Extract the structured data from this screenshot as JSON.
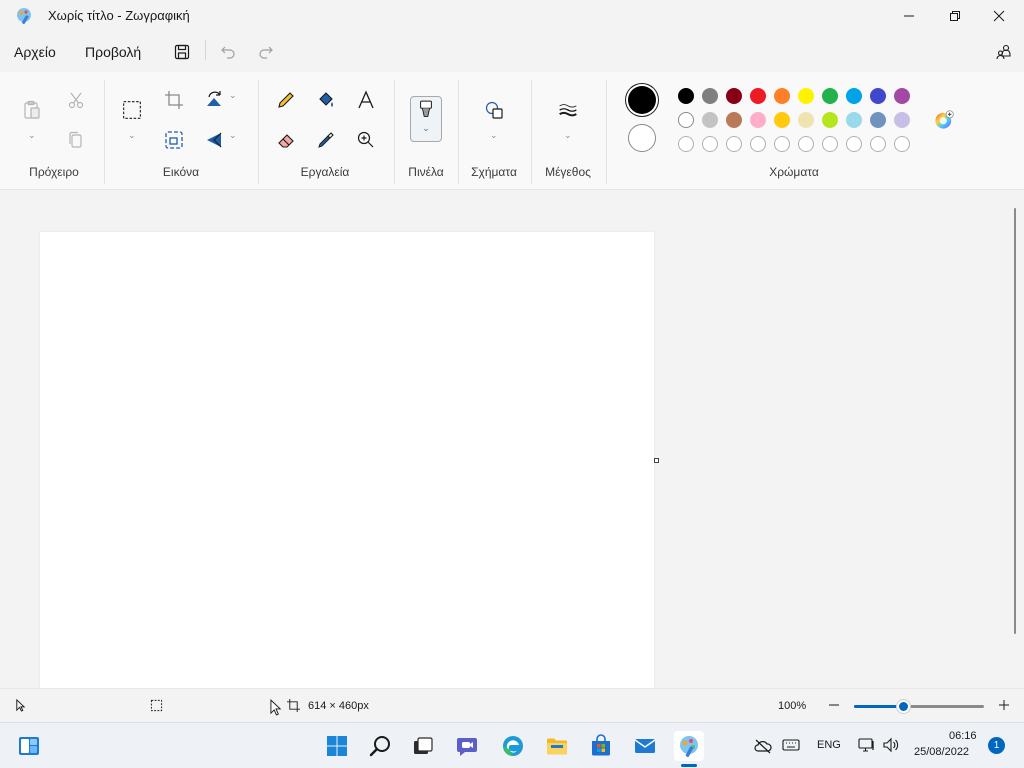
{
  "window": {
    "title": "Χωρίς τίτλο - Ζωγραφική"
  },
  "menu": {
    "file": "Αρχείο",
    "view": "Προβολή"
  },
  "ribbon": {
    "groups": {
      "clipboard": "Πρόχειρο",
      "image": "Εικόνα",
      "tools": "Εργαλεία",
      "brushes": "Πινέλα",
      "shapes": "Σχήματα",
      "size": "Μέγεθος",
      "colors": "Χρώματα"
    },
    "colors": {
      "primary": "#000000",
      "secondary": "#ffffff",
      "palette_row1": [
        "#000000",
        "#7f7f7f",
        "#880015",
        "#ed1c24",
        "#ff7f27",
        "#fff200",
        "#22b14c",
        "#00a2e8",
        "#3f48cc",
        "#a349a4"
      ],
      "palette_row2": [
        "#ffffff",
        "#c3c3c3",
        "#b97a57",
        "#ffaec9",
        "#ffc90e",
        "#efe4b0",
        "#b5e61d",
        "#99d9ea",
        "#7092be",
        "#c8bfe7"
      ],
      "palette_row3_empty_count_label": ""
    }
  },
  "status": {
    "canvas_size": "614 × 460px",
    "zoom": "100%",
    "zoom_fraction": 0.38
  },
  "taskbar": {
    "language": "ENG",
    "time": "06:16",
    "date": "25/08/2022",
    "notifications": "1"
  }
}
